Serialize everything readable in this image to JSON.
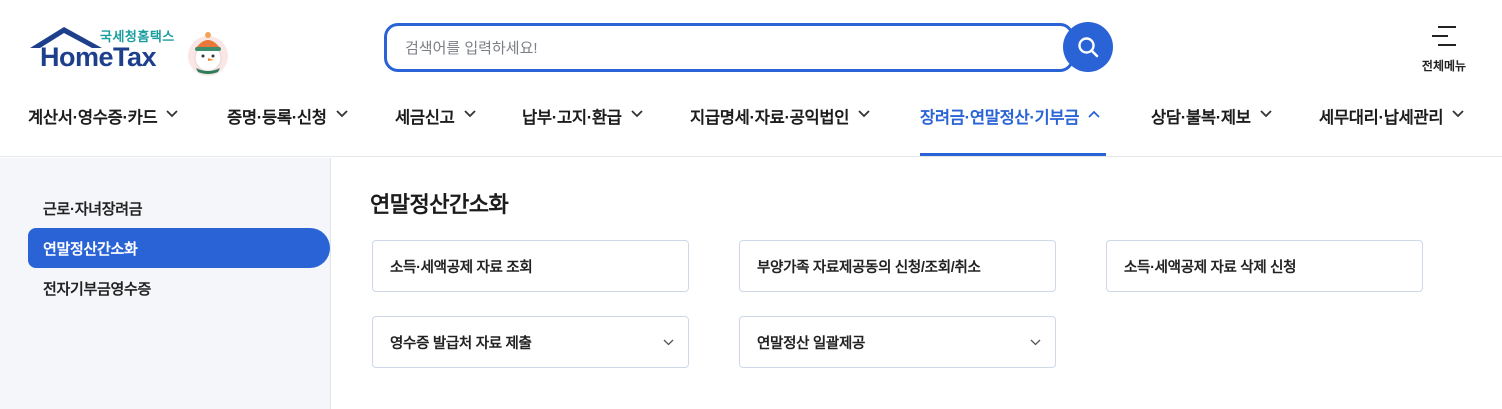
{
  "logo": {
    "korean": "국세청홈택스",
    "english": "HomeTax"
  },
  "search": {
    "placeholder": "검색어를 입력하세요!",
    "value": ""
  },
  "all_menu": {
    "label": "전체메뉴"
  },
  "gnb": {
    "items": [
      {
        "label": "계산서·영수증·카드",
        "expanded": false
      },
      {
        "label": "증명·등록·신청",
        "expanded": false
      },
      {
        "label": "세금신고",
        "expanded": false
      },
      {
        "label": "납부·고지·환급",
        "expanded": false
      },
      {
        "label": "지급명세·자료·공익법인",
        "expanded": false
      },
      {
        "label": "장려금·연말정산·기부금",
        "expanded": true
      },
      {
        "label": "상담·불복·제보",
        "expanded": false
      },
      {
        "label": "세무대리·납세관리",
        "expanded": false
      }
    ]
  },
  "lnb": {
    "items": [
      {
        "label": "근로·자녀장려금",
        "active": false
      },
      {
        "label": "연말정산간소화",
        "active": true
      },
      {
        "label": "전자기부금영수증",
        "active": false
      }
    ]
  },
  "content": {
    "title": "연말정산간소화",
    "cards": [
      {
        "label": "소득·세액공제 자료 조회",
        "has_dropdown": false
      },
      {
        "label": "부양가족 자료제공동의 신청/조회/취소",
        "has_dropdown": false
      },
      {
        "label": "소득·세액공제 자료 삭제 신청",
        "has_dropdown": false
      },
      {
        "label": "영수증 발급처 자료 제출",
        "has_dropdown": true
      },
      {
        "label": "연말정산 일괄제공",
        "has_dropdown": true
      }
    ]
  },
  "colors": {
    "accent": "#2a63d6",
    "brand_navy": "#1e3f8c",
    "brand_teal": "#1a9ea0",
    "sidebar_bg": "#f4f6fa"
  }
}
